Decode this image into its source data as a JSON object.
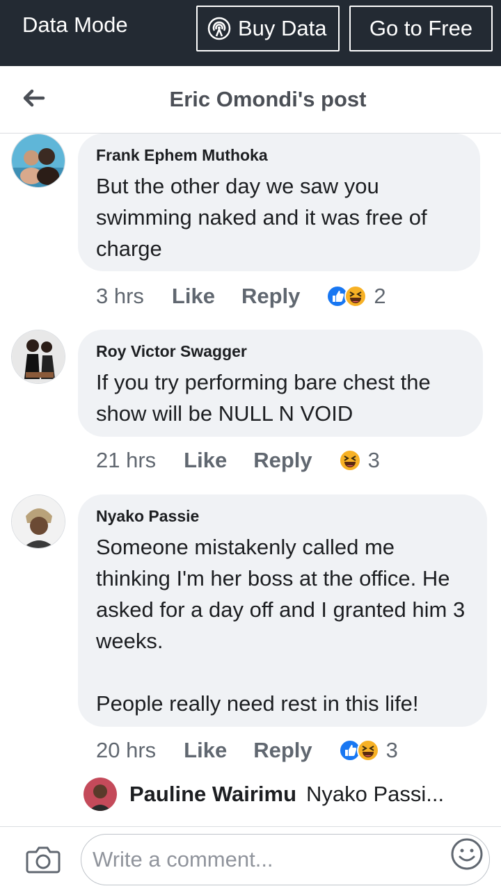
{
  "data_bar": {
    "mode_label": "Data Mode",
    "buy_label": "Buy Data",
    "free_label": "Go to Free"
  },
  "header": {
    "title": "Eric Omondi's post"
  },
  "comments": [
    {
      "author": "Frank Ephem Muthoka",
      "text": "But the other day we saw you swimming naked and it was free of charge",
      "time": "3 hrs",
      "like": "Like",
      "reply": "Reply",
      "reactions": [
        "like-icon",
        "haha-icon"
      ],
      "count": "2"
    },
    {
      "author": "Roy Victor Swagger",
      "text": "If you try performing bare chest the show will be NULL N VOID",
      "time": "21 hrs",
      "like": "Like",
      "reply": "Reply",
      "reactions": [
        "haha-icon"
      ],
      "count": "3"
    },
    {
      "author": "Nyako Passie",
      "text": "Someone mistakenly called me thinking I'm her boss at the office. He asked for a day off and I granted him 3 weeks.\n\nPeople really need rest in this life!",
      "time": "20 hrs",
      "like": "Like",
      "reply": "Reply",
      "reactions": [
        "like-icon",
        "haha-icon"
      ],
      "count": "3"
    }
  ],
  "reply_preview": {
    "author": "Pauline Wairimu",
    "text": "Nyako Passi..."
  },
  "composer": {
    "placeholder": "Write a comment..."
  },
  "colors": {
    "like_blue": "#1877f2",
    "haha_yellow": "#f7b125",
    "bar_bg": "#232a33"
  }
}
